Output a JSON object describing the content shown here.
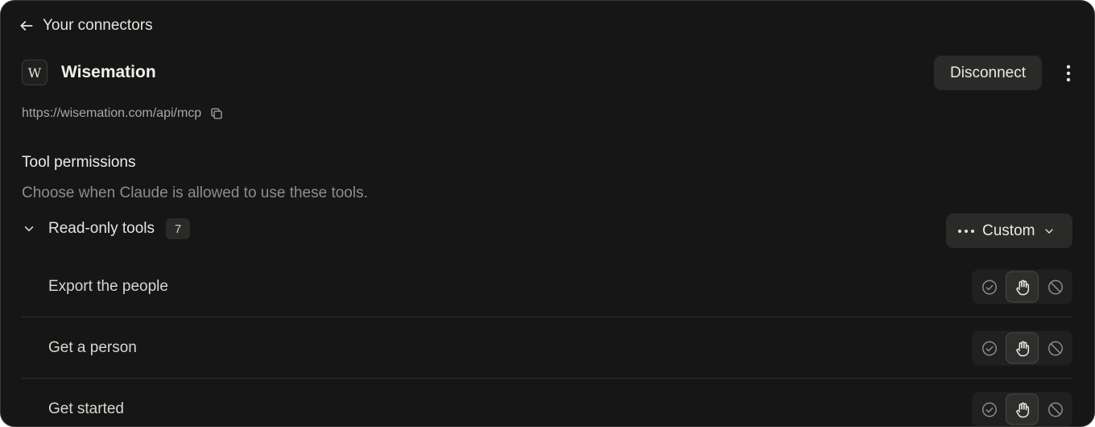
{
  "nav": {
    "back_label": "Your connectors"
  },
  "connector": {
    "logo_letter": "W",
    "name": "Wisemation",
    "url": "https://wisemation.com/api/mcp",
    "disconnect_label": "Disconnect"
  },
  "permissions": {
    "title": "Tool permissions",
    "subtitle": "Choose when Claude is allowed to use these tools.",
    "group": {
      "label": "Read-only tools",
      "count": "7",
      "mode_label": "Custom"
    },
    "tools": [
      {
        "name": "Export the people",
        "selected": "ask"
      },
      {
        "name": "Get a person",
        "selected": "ask"
      },
      {
        "name": "Get started",
        "selected": "ask"
      }
    ]
  },
  "permission_options": [
    "allow",
    "ask",
    "block"
  ],
  "icons": {
    "back": "arrow-left-icon",
    "more": "more-vertical-icon",
    "copy": "copy-icon",
    "chevron": "chevron-down-icon",
    "custom": "more-horizontal-icon",
    "allow": "check-circle-icon",
    "ask": "hand-icon",
    "block": "block-icon"
  },
  "colors": {
    "background": "#161616",
    "text": "#e6e4dd",
    "muted": "#8f8d86",
    "button": "#2a2a29"
  }
}
